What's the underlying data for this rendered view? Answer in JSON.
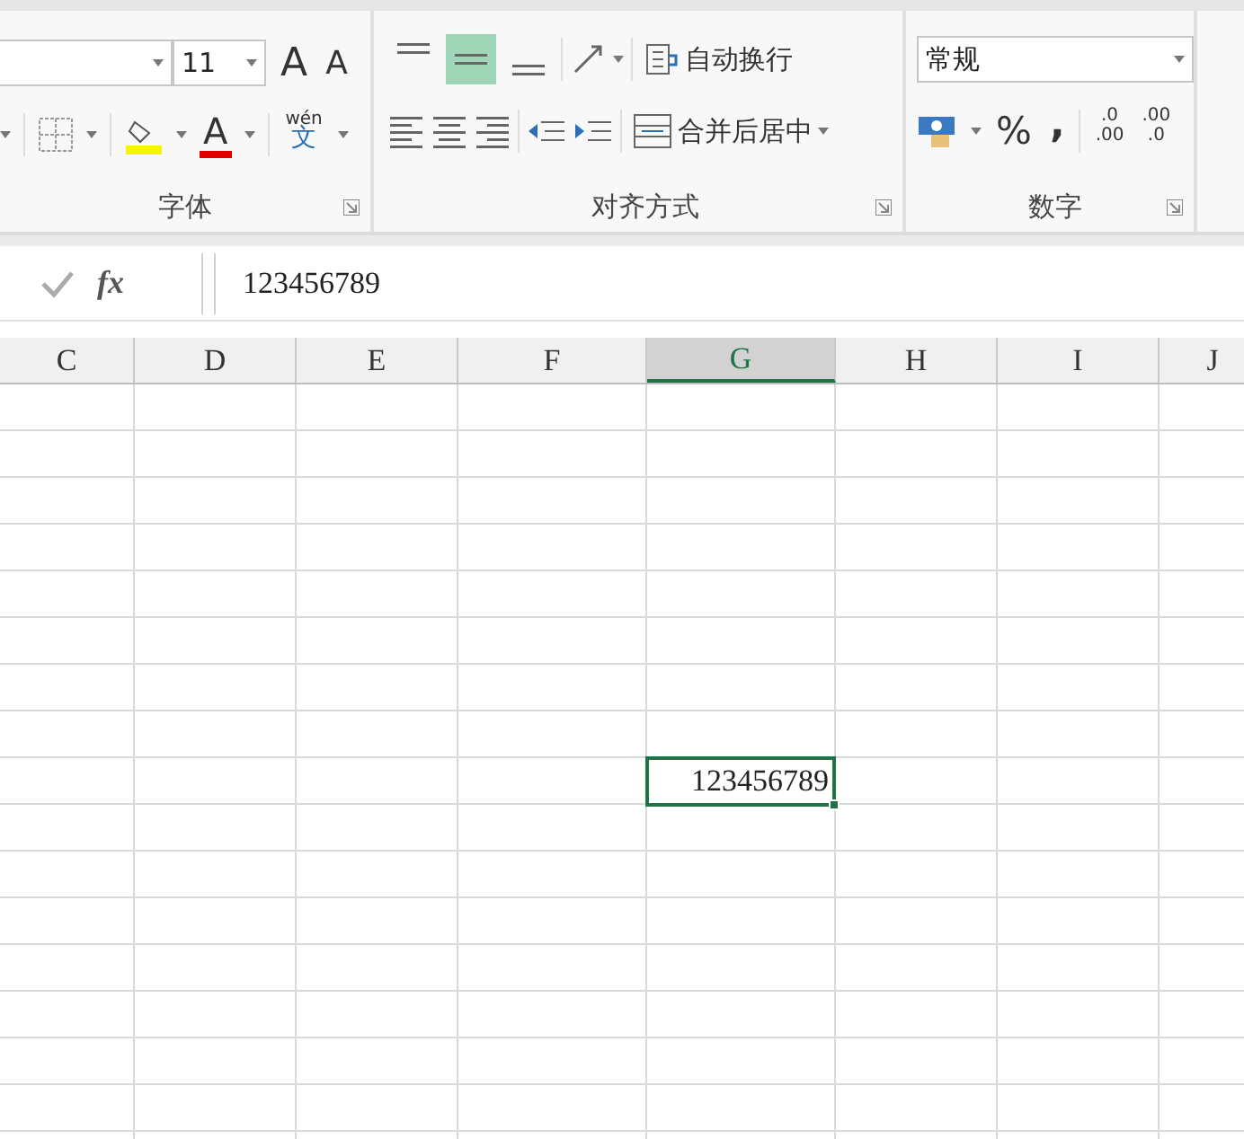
{
  "ribbon": {
    "font_group": {
      "font_size": "11",
      "grow_font": "A",
      "shrink_font": "A",
      "font_color_label": "A",
      "phonetic_top": "wén",
      "phonetic_bottom": "文",
      "label": "字体"
    },
    "alignment_group": {
      "vertical_align": [
        {
          "kind": "top",
          "selected": false
        },
        {
          "kind": "middle",
          "selected": true
        },
        {
          "kind": "bottom",
          "selected": false
        }
      ],
      "wrap_text": "自动换行",
      "merge_center": "合并后居中",
      "label": "对齐方式"
    },
    "number_group": {
      "format": "常规",
      "percent": "%",
      "comma": ",",
      "increase_decimal": [
        ".0",
        ".00"
      ],
      "decrease_decimal": [
        ".00",
        ".0"
      ],
      "label": "数字"
    }
  },
  "formula_bar": {
    "function_label": "fx",
    "value": "123456789"
  },
  "columns": [
    {
      "label": "C",
      "selected": false
    },
    {
      "label": "D",
      "selected": false
    },
    {
      "label": "E",
      "selected": false
    },
    {
      "label": "F",
      "selected": false
    },
    {
      "label": "G",
      "selected": true
    },
    {
      "label": "H",
      "selected": false
    },
    {
      "label": "I",
      "selected": false
    },
    {
      "label": "J",
      "selected": false
    }
  ],
  "active_cell": {
    "value": "123456789"
  }
}
